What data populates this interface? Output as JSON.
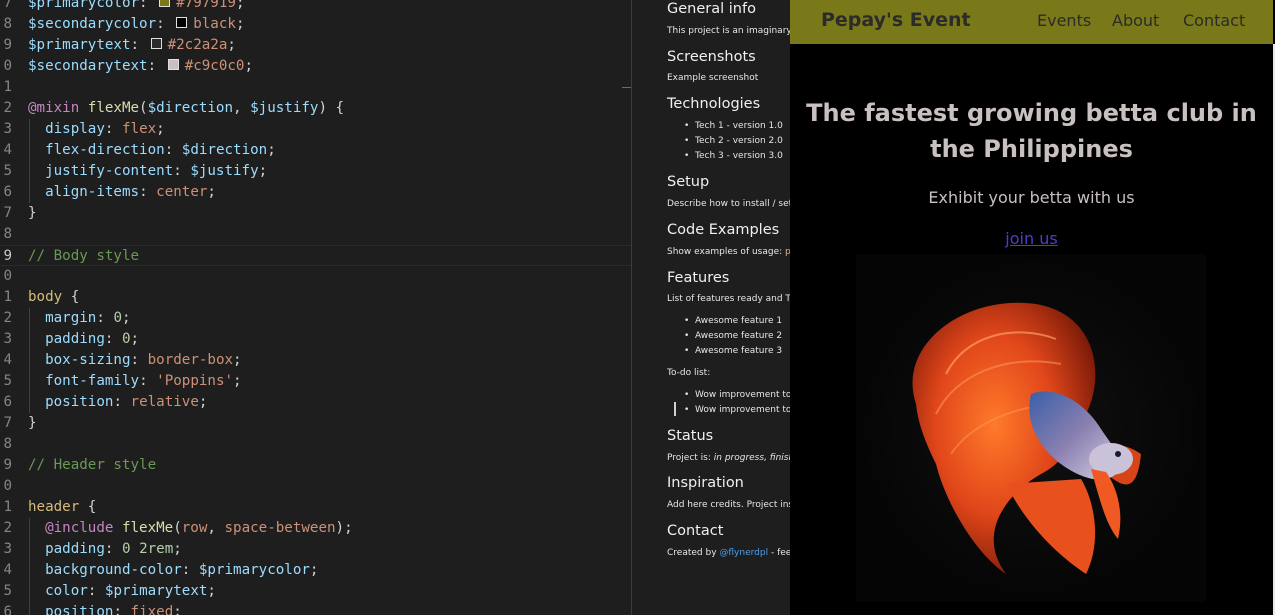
{
  "editor": {
    "lines": [
      {
        "n": "7",
        "parts": [
          [
            "var",
            "$primarycolor"
          ],
          [
            "p",
            ": "
          ],
          [
            "sw",
            "#797919"
          ],
          [
            "val",
            "#797919"
          ],
          [
            "p",
            ";"
          ]
        ]
      },
      {
        "n": "8",
        "parts": [
          [
            "var",
            "$secondarycolor"
          ],
          [
            "p",
            ": "
          ],
          [
            "sw",
            "#000000"
          ],
          [
            "val",
            "black"
          ],
          [
            "p",
            ";"
          ]
        ]
      },
      {
        "n": "9",
        "parts": [
          [
            "var",
            "$primarytext"
          ],
          [
            "p",
            ": "
          ],
          [
            "sw",
            "#2c2a2a"
          ],
          [
            "val",
            "#2c2a2a"
          ],
          [
            "p",
            ";"
          ]
        ]
      },
      {
        "n": "0",
        "parts": [
          [
            "var",
            "$secondarytext"
          ],
          [
            "p",
            ": "
          ],
          [
            "sw",
            "#c9c0c0"
          ],
          [
            "val",
            "#c9c0c0"
          ],
          [
            "p",
            ";"
          ]
        ]
      },
      {
        "n": "1",
        "parts": []
      },
      {
        "n": "2",
        "parts": [
          [
            "at",
            "@mixin "
          ],
          [
            "fn",
            "flexMe"
          ],
          [
            "p",
            "("
          ],
          [
            "var",
            "$direction"
          ],
          [
            "p",
            ", "
          ],
          [
            "var",
            "$justify"
          ],
          [
            "p",
            ") {"
          ]
        ]
      },
      {
        "n": "3",
        "parts": [
          [
            "p",
            "  "
          ],
          [
            "prop",
            "display"
          ],
          [
            "p",
            ": "
          ],
          [
            "val",
            "flex"
          ],
          [
            "p",
            ";"
          ]
        ]
      },
      {
        "n": "4",
        "parts": [
          [
            "p",
            "  "
          ],
          [
            "prop",
            "flex-direction"
          ],
          [
            "p",
            ": "
          ],
          [
            "var",
            "$direction"
          ],
          [
            "p",
            ";"
          ]
        ]
      },
      {
        "n": "5",
        "parts": [
          [
            "p",
            "  "
          ],
          [
            "prop",
            "justify-content"
          ],
          [
            "p",
            ": "
          ],
          [
            "var",
            "$justify"
          ],
          [
            "p",
            ";"
          ]
        ]
      },
      {
        "n": "6",
        "parts": [
          [
            "p",
            "  "
          ],
          [
            "prop",
            "align-items"
          ],
          [
            "p",
            ": "
          ],
          [
            "val",
            "center"
          ],
          [
            "p",
            ";"
          ]
        ]
      },
      {
        "n": "7",
        "parts": [
          [
            "p",
            "}"
          ]
        ]
      },
      {
        "n": "8",
        "parts": []
      },
      {
        "n": "9",
        "parts": [
          [
            "com",
            "// Body style"
          ]
        ]
      },
      {
        "n": "0",
        "parts": []
      },
      {
        "n": "1",
        "parts": [
          [
            "sel",
            "body"
          ],
          [
            "p",
            " {"
          ]
        ]
      },
      {
        "n": "2",
        "parts": [
          [
            "p",
            "  "
          ],
          [
            "prop",
            "margin"
          ],
          [
            "p",
            ": "
          ],
          [
            "num",
            "0"
          ],
          [
            "p",
            ";"
          ]
        ]
      },
      {
        "n": "3",
        "parts": [
          [
            "p",
            "  "
          ],
          [
            "prop",
            "padding"
          ],
          [
            "p",
            ": "
          ],
          [
            "num",
            "0"
          ],
          [
            "p",
            ";"
          ]
        ]
      },
      {
        "n": "4",
        "parts": [
          [
            "p",
            "  "
          ],
          [
            "prop",
            "box-sizing"
          ],
          [
            "p",
            ": "
          ],
          [
            "val",
            "border-box"
          ],
          [
            "p",
            ";"
          ]
        ]
      },
      {
        "n": "5",
        "parts": [
          [
            "p",
            "  "
          ],
          [
            "prop",
            "font-family"
          ],
          [
            "p",
            ": "
          ],
          [
            "val",
            "'Poppins'"
          ],
          [
            "p",
            ";"
          ]
        ]
      },
      {
        "n": "6",
        "parts": [
          [
            "p",
            "  "
          ],
          [
            "prop",
            "position"
          ],
          [
            "p",
            ": "
          ],
          [
            "val",
            "relative"
          ],
          [
            "p",
            ";"
          ]
        ]
      },
      {
        "n": "7",
        "parts": [
          [
            "p",
            "}"
          ]
        ]
      },
      {
        "n": "8",
        "parts": []
      },
      {
        "n": "9",
        "parts": [
          [
            "com",
            "// Header style"
          ]
        ]
      },
      {
        "n": "0",
        "parts": []
      },
      {
        "n": "1",
        "parts": [
          [
            "sel",
            "header"
          ],
          [
            "p",
            " {"
          ]
        ]
      },
      {
        "n": "2",
        "parts": [
          [
            "p",
            "  "
          ],
          [
            "at",
            "@include "
          ],
          [
            "fn",
            "flexMe"
          ],
          [
            "p",
            "("
          ],
          [
            "val",
            "row"
          ],
          [
            "p",
            ", "
          ],
          [
            "val",
            "space-between"
          ],
          [
            "p",
            ");"
          ]
        ]
      },
      {
        "n": "3",
        "parts": [
          [
            "p",
            "  "
          ],
          [
            "prop",
            "padding"
          ],
          [
            "p",
            ": "
          ],
          [
            "num",
            "0"
          ],
          [
            "p",
            " "
          ],
          [
            "num",
            "2rem"
          ],
          [
            "p",
            ";"
          ]
        ]
      },
      {
        "n": "4",
        "parts": [
          [
            "p",
            "  "
          ],
          [
            "prop",
            "background-color"
          ],
          [
            "p",
            ": "
          ],
          [
            "var",
            "$primarycolor"
          ],
          [
            "p",
            ";"
          ]
        ]
      },
      {
        "n": "5",
        "parts": [
          [
            "p",
            "  "
          ],
          [
            "prop",
            "color"
          ],
          [
            "p",
            ": "
          ],
          [
            "var",
            "$primarytext"
          ],
          [
            "p",
            ";"
          ]
        ]
      },
      {
        "n": "6",
        "parts": [
          [
            "p",
            "  "
          ],
          [
            "prop",
            "position"
          ],
          [
            "p",
            ": "
          ],
          [
            "val",
            "fixed"
          ],
          [
            "p",
            ";"
          ]
        ]
      }
    ]
  },
  "readme": {
    "general_info": "General info",
    "general_text": "This project is an imaginary l",
    "screenshots": "Screenshots",
    "screenshot_alt": "Example screenshot",
    "technologies": "Technologies",
    "tech": [
      "Tech 1 - version 1.0",
      "Tech 2 - version 2.0",
      "Tech 3 - version 3.0"
    ],
    "setup": "Setup",
    "setup_text": "Describe how to install / setu",
    "code_examples": "Code Examples",
    "code_text": "Show examples of usage: ",
    "code_mark": "pu",
    "features": "Features",
    "features_text": "List of features ready and TO",
    "feature_items": [
      "Awesome feature 1",
      "Awesome feature 2",
      "Awesome feature 3"
    ],
    "todo_label": "To-do list:",
    "todo_items": [
      "Wow improvement to",
      "Wow improvement to"
    ],
    "status": "Status",
    "status_prefix": "Project is: ",
    "status_value": "in progress, finishe",
    "inspiration": "Inspiration",
    "inspiration_text": "Add here credits. Project insp",
    "contact": "Contact",
    "contact_prefix": "Created by ",
    "contact_link": "@flynerdpl",
    "contact_suffix": " - feel"
  },
  "site": {
    "brand": "Pepay's Event",
    "nav": [
      "Events",
      "About",
      "Contact"
    ],
    "hero_title": "The fastest growing betta club in the Philippines",
    "subtitle": "Exhibit your betta with us",
    "join_link": "join us",
    "photo_icon": "betta-fish-photo",
    "colors": {
      "header_bg": "#797919",
      "primary_text": "#2c2a2a",
      "secondary_text": "#c9c0c0",
      "link": "#5a35d4"
    }
  }
}
